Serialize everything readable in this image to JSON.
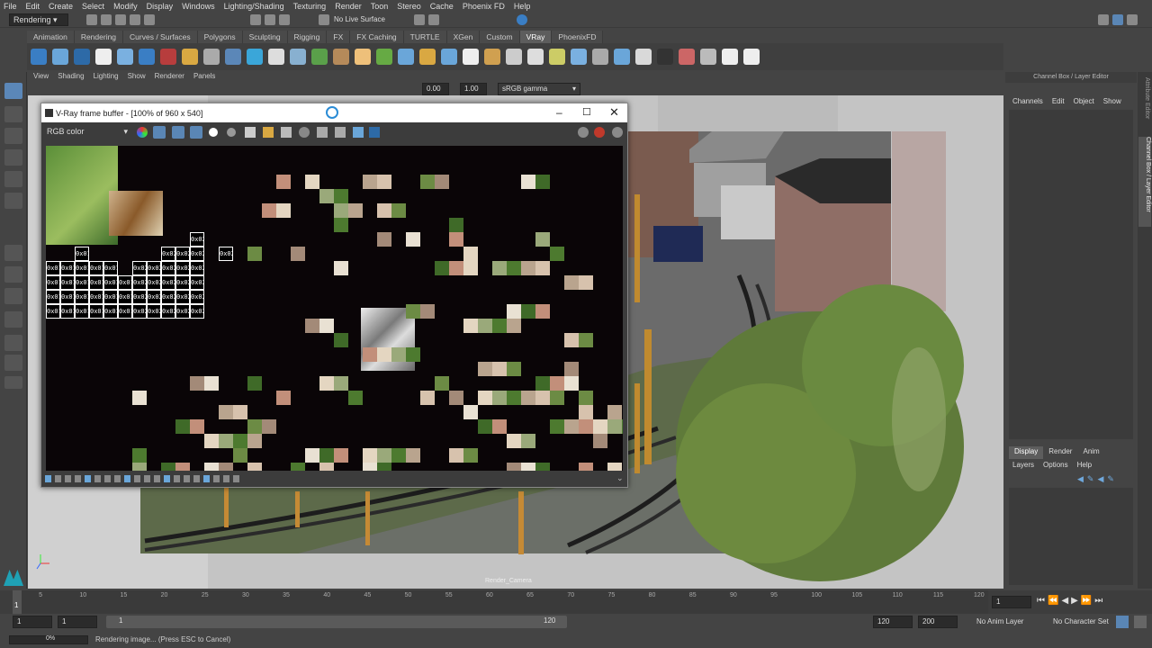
{
  "menubar": [
    "File",
    "Edit",
    "Create",
    "Select",
    "Modify",
    "Display",
    "Windows",
    "Lighting/Shading",
    "Texturing",
    "Render",
    "Toon",
    "Stereo",
    "Cache",
    "Phoenix FD",
    "Help"
  ],
  "status": {
    "menuset": "Rendering",
    "live_surface": "No Live Surface"
  },
  "shelf_tabs": [
    "Animation",
    "Rendering",
    "Curves / Surfaces",
    "Polygons",
    "Sculpting",
    "Rigging",
    "FX",
    "FX Caching",
    "TURTLE",
    "XGen",
    "Custom",
    "VRay",
    "PhoenixFD"
  ],
  "shelf_active": "VRay",
  "panel_menu": [
    "View",
    "Shading",
    "Lighting",
    "Show",
    "Renderer",
    "Panels"
  ],
  "panel_tools": {
    "exposure": "0.00",
    "gamma": "1.00",
    "colorspace": "sRGB gamma"
  },
  "viewport": {
    "camera_label": "Render_Camera"
  },
  "vfb": {
    "title": "V-Ray frame buffer - [100% of 960 x 540]",
    "channel": "RGB color",
    "bucket_labels": [
      "0x01",
      "0x02"
    ]
  },
  "channel_box": {
    "title": "Channel Box / Layer Editor",
    "menu": [
      "Channels",
      "Edit",
      "Object",
      "Show"
    ],
    "side_tabs": [
      "Attribute Editor",
      "Channel Box / Layer Editor"
    ]
  },
  "layer_editor": {
    "tabs": [
      "Display",
      "Render",
      "Anim"
    ],
    "active_tab": "Display",
    "menu": [
      "Layers",
      "Options",
      "Help"
    ]
  },
  "timeline": {
    "ticks": [
      "5",
      "10",
      "15",
      "20",
      "25",
      "30",
      "35",
      "40",
      "45",
      "50",
      "55",
      "60",
      "65",
      "70",
      "75",
      "80",
      "85",
      "90",
      "95",
      "100",
      "105",
      "110",
      "115",
      "120"
    ],
    "current_frame": "1",
    "current_frame_field": "1"
  },
  "range": {
    "start": "1",
    "start_inner": "1",
    "slider_start": "1",
    "slider_end": "120",
    "end_inner": "120",
    "end": "200",
    "anim_layer": "No Anim Layer",
    "char_set": "No Character Set"
  },
  "commandline": {
    "progress": "0%",
    "message": "Rendering image... (Press ESC to Cancel)"
  }
}
